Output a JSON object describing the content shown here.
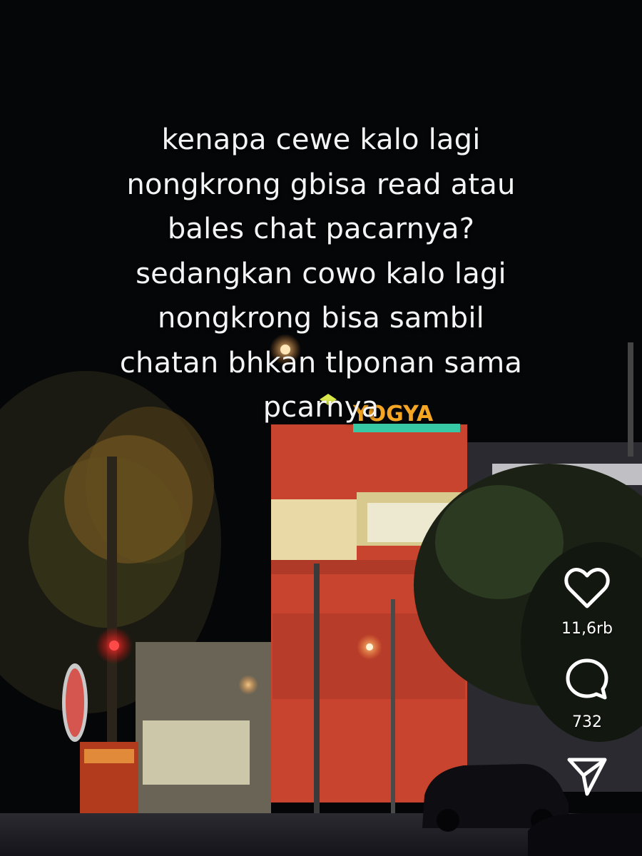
{
  "caption": {
    "lines": [
      "kenapa cewe kalo lagi",
      "nongkrong gbisa read atau",
      "bales chat pacarnya?",
      "sedangkan cowo kalo lagi",
      "nongkrong bisa sambil",
      "chatan bhkan tlponan sama",
      "pcarnya"
    ]
  },
  "scene": {
    "store_sign": "YOGYA"
  },
  "actions": {
    "like": {
      "icon": "heart-icon",
      "count": "11,6rb"
    },
    "comment": {
      "icon": "comment-bubble-icon",
      "count": "732"
    },
    "share": {
      "icon": "send-paper-plane-icon"
    }
  },
  "colors": {
    "icon": "#ffffff",
    "building_red": "#c8442e",
    "building_cream": "#e8d9a6",
    "sky": "#050608"
  }
}
